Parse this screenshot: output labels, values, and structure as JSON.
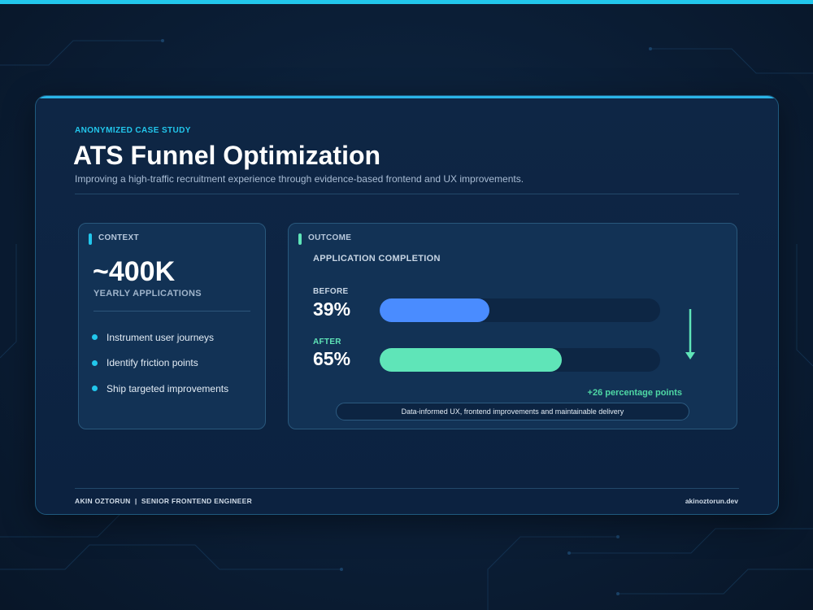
{
  "theme": {
    "accent": "#22c7ec",
    "before_color": "#4a8cff",
    "after_color": "#5fe5b8",
    "delta_color": "#4fd8a5",
    "background": "#0b1d33"
  },
  "header": {
    "eyebrow": "ANONYMIZED CASE STUDY",
    "title": "ATS Funnel Optimization",
    "subtitle": "Improving a high-traffic recruitment experience through evidence-based frontend and UX improvements."
  },
  "context": {
    "tag": "CONTEXT",
    "stat": "~400K",
    "stat_label": "YEARLY APPLICATIONS",
    "bullets": [
      "Instrument user journeys",
      "Identify friction points",
      "Ship targeted improvements"
    ]
  },
  "outcome": {
    "tag": "OUTCOME",
    "metric_title": "APPLICATION COMPLETION",
    "before": {
      "label": "BEFORE",
      "value_text": "39%",
      "value": 0.39
    },
    "after": {
      "label": "AFTER",
      "value_text": "65%",
      "value": 0.65
    },
    "delta": "+26 percentage points",
    "note": "Data-informed UX, frontend improvements and maintainable delivery",
    "arrow_icon": "arrow-down-icon"
  },
  "footer": {
    "byline": "AKIN OZTORUN  |  SENIOR FRONTEND ENGINEER",
    "website": "akinoztorun.dev"
  }
}
